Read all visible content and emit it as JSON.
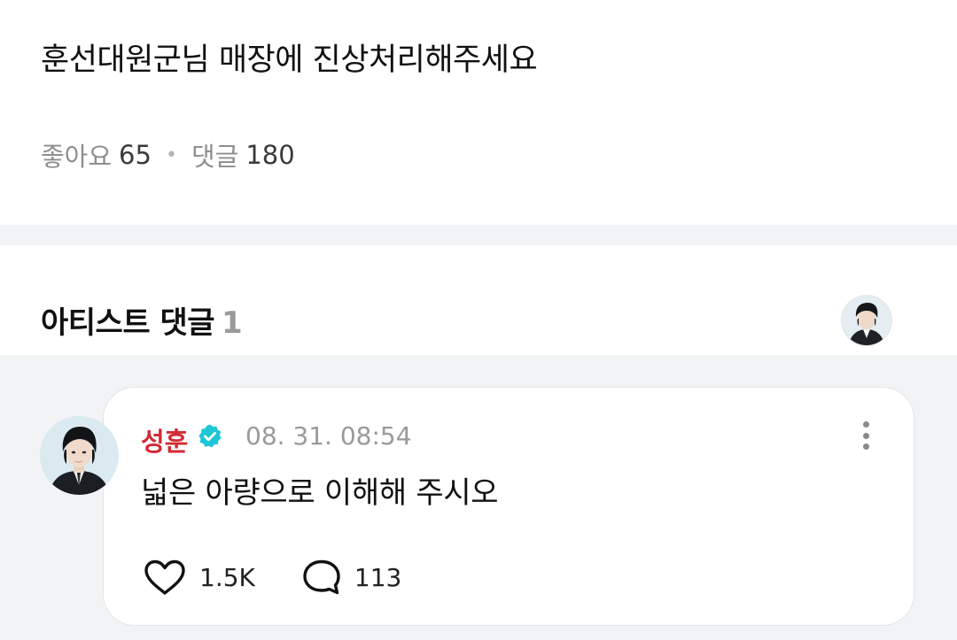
{
  "post": {
    "title": "훈선대원군님 매장에 진상처리해주세요",
    "likes_label": "좋아요",
    "likes_count": "65",
    "comments_label": "댓글",
    "comments_count": "180"
  },
  "artist_comments": {
    "title": "아티스트 댓글",
    "count": "1"
  },
  "comment": {
    "author": "성훈",
    "verified": true,
    "timestamp": "08. 31. 08:54",
    "text": "넓은 아량으로 이해해 주시오",
    "like_count": "1.5K",
    "reply_count": "113"
  },
  "colors": {
    "author": "#d32a33",
    "verified_badge": "#1fc6d6",
    "background_band": "#f2f3f5"
  },
  "icons": {
    "verified": "verified-badge-icon",
    "more": "more-vertical-icon",
    "like": "heart-outline-icon",
    "reply": "speech-bubble-icon"
  }
}
